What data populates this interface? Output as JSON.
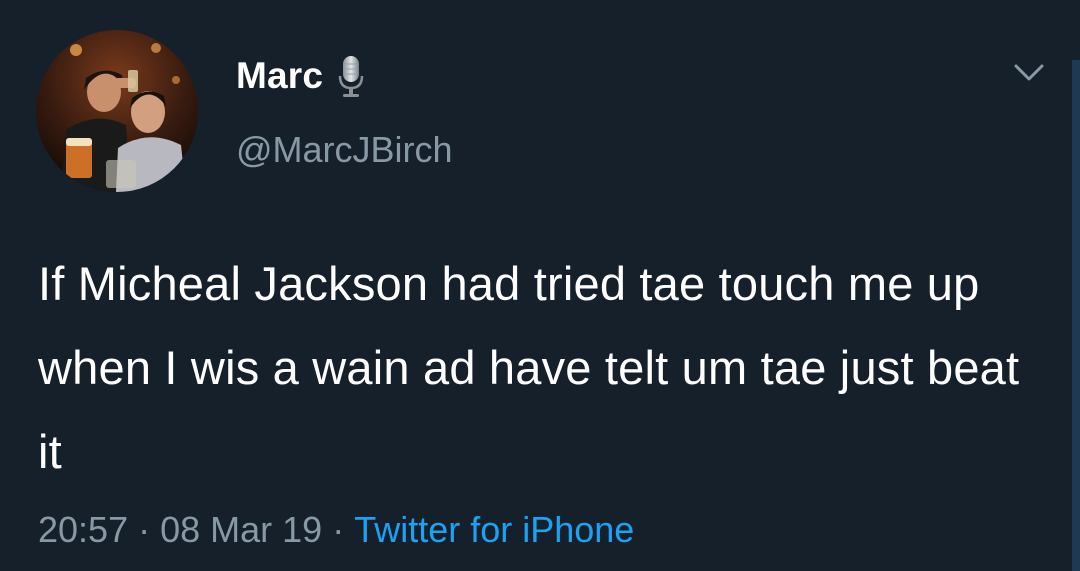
{
  "tweet": {
    "author": {
      "display_name": "Marc",
      "name_emoji_icon": "microphone-icon",
      "handle": "@MarcJBirch",
      "avatar": "profile-photo"
    },
    "text": "If Micheal Jackson had tried tae touch me up when I wis a wain ad have telt um tae just beat it",
    "time": "20:57",
    "separator": "·",
    "date": "08 Mar 19",
    "source": "Twitter for iPhone",
    "menu_icon": "chevron-down-icon"
  },
  "colors": {
    "background": "#15202b",
    "text": "#ffffff",
    "secondary_text": "#8899a6",
    "link": "#1da1f2"
  }
}
